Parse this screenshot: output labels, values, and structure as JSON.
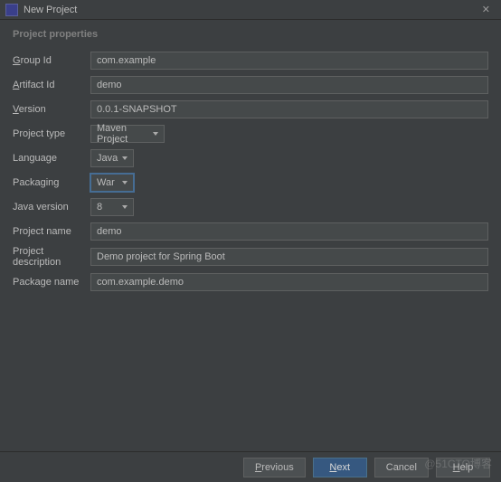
{
  "window": {
    "title": "New Project",
    "iconLetter": "IJ"
  },
  "section": {
    "header": "Project properties"
  },
  "labels": {
    "groupId": "Group Id",
    "artifactId": "Artifact Id",
    "version": "Version",
    "projectType": "Project type",
    "language": "Language",
    "packaging": "Packaging",
    "javaVersion": "Java version",
    "projectName": "Project name",
    "projectDescription": "Project description",
    "packageName": "Package name"
  },
  "underlineLetters": {
    "groupId": "G",
    "artifactId": "A",
    "version": "V"
  },
  "values": {
    "groupId": "com.example",
    "artifactId": "demo",
    "version": "0.0.1-SNAPSHOT",
    "projectType": "Maven Project",
    "language": "Java",
    "packaging": "War",
    "javaVersion": "8",
    "projectName": "demo",
    "projectDescription": "Demo project for Spring Boot",
    "packageName": "com.example.demo"
  },
  "buttons": {
    "previous": "Previous",
    "next": "Next",
    "cancel": "Cancel",
    "help": "Help"
  },
  "underlineButtons": {
    "previous": "P",
    "next": "N",
    "help": "H"
  },
  "watermark": "@51CTO博客"
}
